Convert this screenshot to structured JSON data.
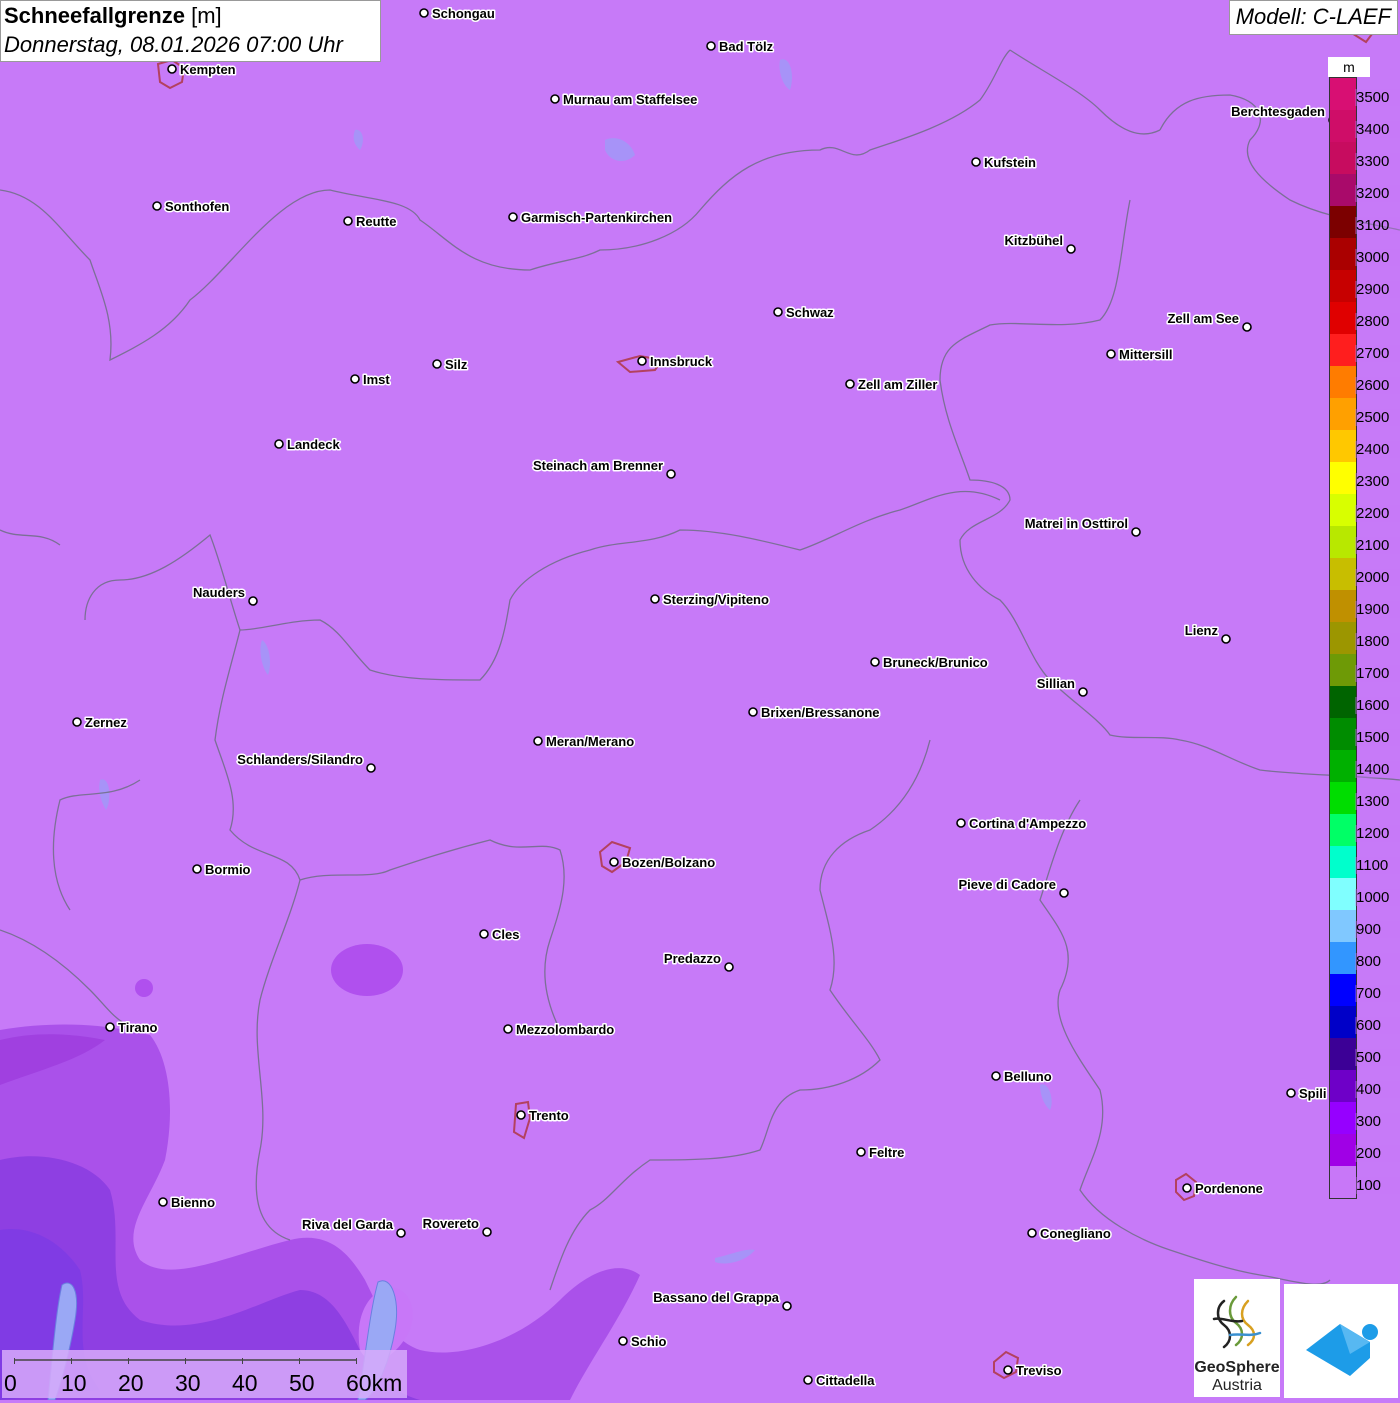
{
  "title": {
    "main": "Schneefallgrenze",
    "unit": "[m]",
    "date": "Donnerstag, 08.01.2026 07:00 Uhr"
  },
  "model": "Modell: C-LAEF",
  "legend": {
    "unit": "m",
    "labels": [
      "3500",
      "3400",
      "3300",
      "3200",
      "3100",
      "3000",
      "2900",
      "2800",
      "2700",
      "2600",
      "2500",
      "2400",
      "2300",
      "2200",
      "2100",
      "2000",
      "1900",
      "1800",
      "1700",
      "1600",
      "1500",
      "1400",
      "1300",
      "1200",
      "1100",
      "1000",
      "900",
      "800",
      "700",
      "600",
      "500",
      "400",
      "300",
      "200",
      "100"
    ],
    "colors": [
      "#d80f73",
      "#cf0d68",
      "#c70c5f",
      "#a90a6a",
      "#7c0000",
      "#aa0000",
      "#c70000",
      "#e00000",
      "#ff1e1e",
      "#ff7c00",
      "#ffa000",
      "#ffc800",
      "#ffff00",
      "#d8ff00",
      "#b8e800",
      "#c8be00",
      "#c09000",
      "#9c9600",
      "#6e9a06",
      "#006400",
      "#008c00",
      "#00b000",
      "#00dd00",
      "#00ff66",
      "#00ffcc",
      "#80ffff",
      "#80c8ff",
      "#3296ff",
      "#0000ff",
      "#0000c8",
      "#3c0096",
      "#6e00c8",
      "#9600ff",
      "#a000e6",
      "#c877f8"
    ]
  },
  "cities": [
    {
      "name": "Schongau",
      "side": "r"
    },
    {
      "name": "Bad Tölz",
      "side": "r"
    },
    {
      "name": "Kempten",
      "side": "r"
    },
    {
      "name": "Murnau am Staffelsee",
      "side": "r"
    },
    {
      "name": "Berchtesgaden",
      "side": "l"
    },
    {
      "name": "Kufstein",
      "side": "r"
    },
    {
      "name": "Sonthofen",
      "side": "r"
    },
    {
      "name": "Reutte",
      "side": "r"
    },
    {
      "name": "Garmisch-Partenkirchen",
      "side": "r"
    },
    {
      "name": "Kitzbühel",
      "side": "l"
    },
    {
      "name": "Schwaz",
      "side": "r"
    },
    {
      "name": "Zell am See",
      "side": "l"
    },
    {
      "name": "Innsbruck",
      "side": "r"
    },
    {
      "name": "Mittersill",
      "side": "r"
    },
    {
      "name": "Silz",
      "side": "r"
    },
    {
      "name": "Imst",
      "side": "r"
    },
    {
      "name": "Zell am Ziller",
      "side": "r"
    },
    {
      "name": "Landeck",
      "side": "r"
    },
    {
      "name": "Steinach am Brenner",
      "side": "l"
    },
    {
      "name": "Matrei in Osttirol",
      "side": "l"
    },
    {
      "name": "Nauders",
      "side": "l"
    },
    {
      "name": "Sterzing/Vipiteno",
      "side": "r"
    },
    {
      "name": "Lienz",
      "side": "l"
    },
    {
      "name": "Bruneck/Brunico",
      "side": "r"
    },
    {
      "name": "Sillian",
      "side": "l"
    },
    {
      "name": "Zernez",
      "side": "r"
    },
    {
      "name": "Brixen/Bressanone",
      "side": "r"
    },
    {
      "name": "Meran/Merano",
      "side": "r"
    },
    {
      "name": "Schlanders/Silandro",
      "side": "l"
    },
    {
      "name": "Cortina d'Ampezzo",
      "side": "r"
    },
    {
      "name": "Bormio",
      "side": "r"
    },
    {
      "name": "Bozen/Bolzano",
      "side": "r"
    },
    {
      "name": "Pieve di Cadore",
      "side": "l"
    },
    {
      "name": "Cles",
      "side": "r"
    },
    {
      "name": "Predazzo",
      "side": "l"
    },
    {
      "name": "Tirano",
      "side": "r"
    },
    {
      "name": "Mezzolombardo",
      "side": "r"
    },
    {
      "name": "Belluno",
      "side": "r"
    },
    {
      "name": "Spili",
      "side": "r"
    },
    {
      "name": "Trento",
      "side": "r"
    },
    {
      "name": "Feltre",
      "side": "r"
    },
    {
      "name": "Pordenone",
      "side": "r"
    },
    {
      "name": "Bienno",
      "side": "r"
    },
    {
      "name": "Riva del Garda",
      "side": "l"
    },
    {
      "name": "Rovereto",
      "side": "l"
    },
    {
      "name": "Conegliano",
      "side": "r"
    },
    {
      "name": "Bassano del Grappa",
      "side": "l"
    },
    {
      "name": "Schio",
      "side": "r"
    },
    {
      "name": "Treviso",
      "side": "r"
    },
    {
      "name": "Cittadella",
      "side": "r"
    }
  ],
  "scalebar": {
    "labels": [
      "0",
      "10",
      "20",
      "30",
      "40",
      "50",
      "60km"
    ]
  },
  "logos": {
    "geosphere_name": "GeoSphere",
    "geosphere_sub": "Austria"
  }
}
